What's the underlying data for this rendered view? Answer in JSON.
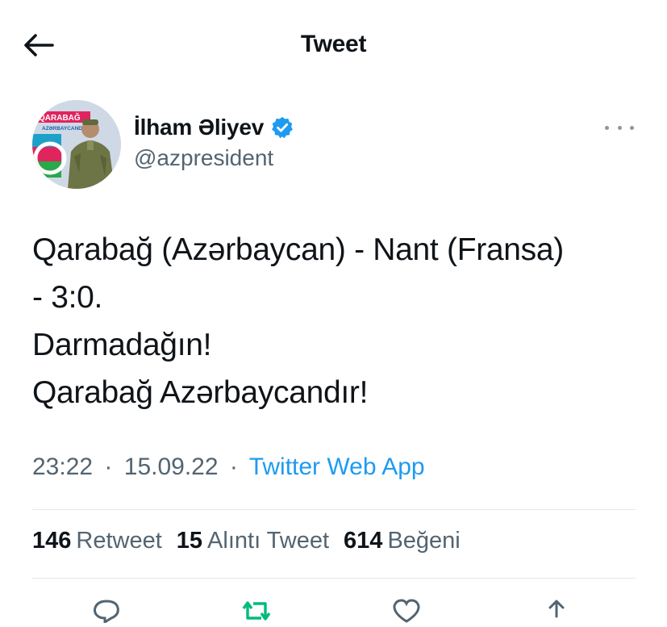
{
  "header": {
    "title": "Tweet"
  },
  "author": {
    "name": "İlham Əliyev",
    "handle": "@azpresident",
    "verified": true,
    "avatar_text_1": "QARABAĞ",
    "avatar_text_2": "AZƏRBAYCANDIR!"
  },
  "tweet": {
    "lines": [
      "Qarabağ (Azərbaycan) - Nant (Fransa)",
      "- 3:0.",
      "Darmadağın!",
      "Qarabağ Azərbaycandır!"
    ],
    "time": "23:22",
    "date": "15.09.22",
    "separator": "·",
    "source": "Twitter Web App"
  },
  "stats": {
    "retweets": "146",
    "retweets_label": "Retweet",
    "quotes": "15",
    "quotes_label": "Alıntı Tweet",
    "likes": "614",
    "likes_label": "Beğeni"
  },
  "colors": {
    "accent": "#1d9bf0",
    "retweet_green": "#00ba7c",
    "secondary_text": "#536471"
  },
  "icons": {
    "back": "arrow-left-icon",
    "verified": "verified-badge-icon",
    "more": "more-dots-icon",
    "reply": "reply-icon",
    "retweet": "retweet-icon",
    "like": "heart-icon",
    "share": "share-icon"
  }
}
